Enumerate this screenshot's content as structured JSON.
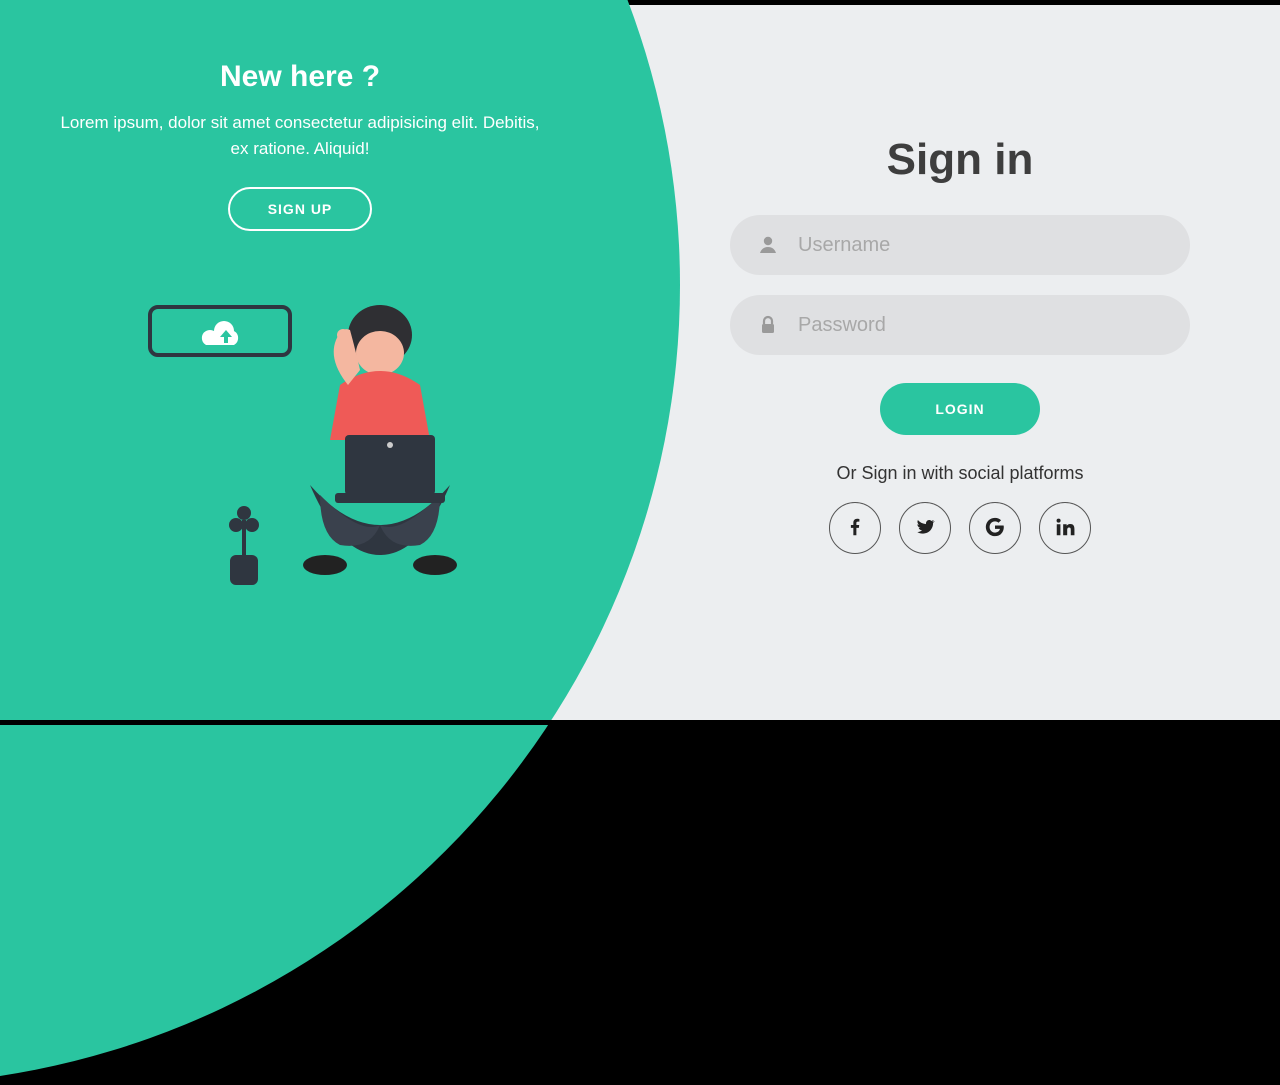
{
  "promo": {
    "heading": "New here ?",
    "body": "Lorem ipsum, dolor sit amet consectetur adipisicing elit. Debitis, ex ratione. Aliquid!",
    "signup_label": "SIGN UP"
  },
  "form": {
    "title": "Sign in",
    "username_placeholder": "Username",
    "password_placeholder": "Password",
    "login_label": "LOGIN",
    "social_label": "Or Sign in with social platforms"
  },
  "social": {
    "facebook": "facebook",
    "twitter": "twitter",
    "google": "google",
    "linkedin": "linkedin"
  }
}
